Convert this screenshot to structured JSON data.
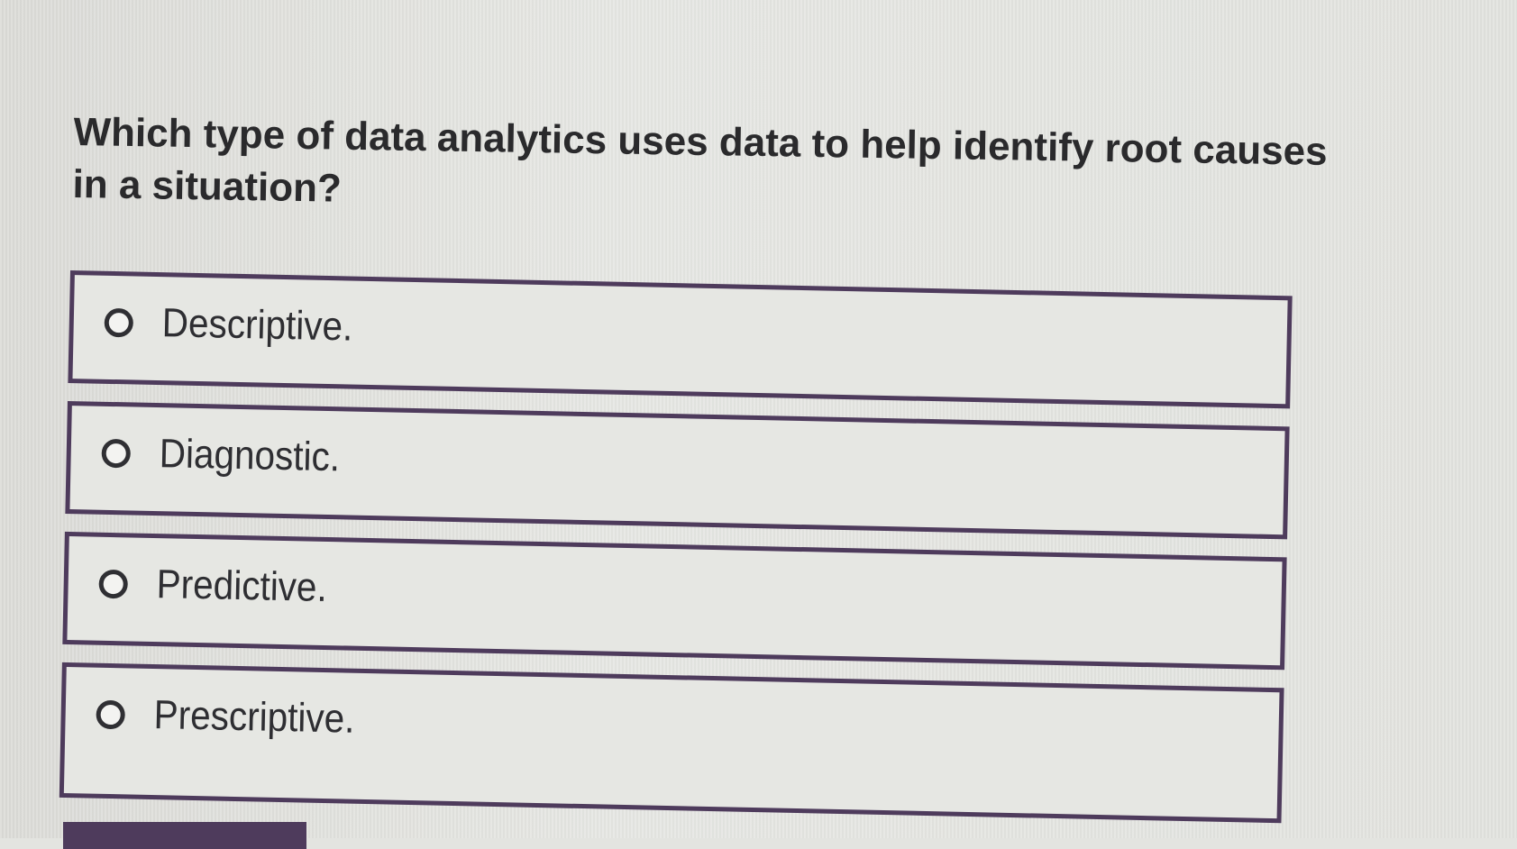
{
  "question": {
    "text": "Which type of data analytics uses data to help identify root causes in a situation?"
  },
  "options": [
    {
      "label": "Descriptive.",
      "selected": false
    },
    {
      "label": "Diagnostic.",
      "selected": false
    },
    {
      "label": "Predictive.",
      "selected": false
    },
    {
      "label": "Prescriptive.",
      "selected": false
    }
  ],
  "colors": {
    "background": "#e3e4e0",
    "option_border": "#4e3b5c",
    "text": "#2a2a2c"
  }
}
